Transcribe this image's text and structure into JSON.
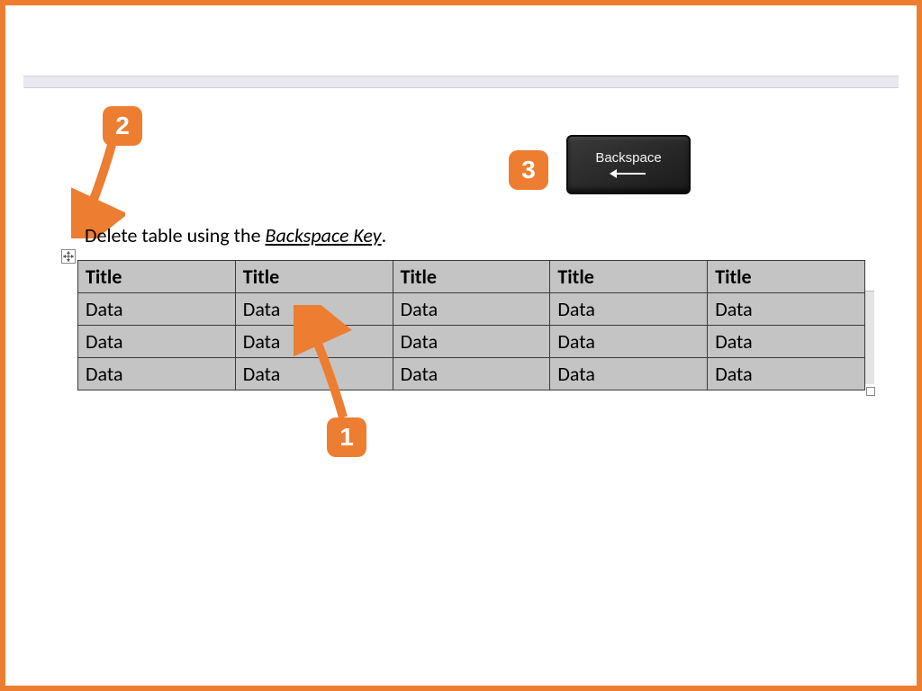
{
  "colors": {
    "accent": "#ed7d31",
    "cell_bg": "#c4c4c4"
  },
  "callouts": {
    "one": "1",
    "two": "2",
    "three": "3"
  },
  "key": {
    "label": "Backspace"
  },
  "instruction": {
    "prefix": "Delete table using the ",
    "emph": "Backspace Key",
    "suffix": "."
  },
  "table": {
    "headers": [
      "Title",
      "Title",
      "Title",
      "Title",
      "Title"
    ],
    "rows": [
      [
        "Data",
        "Data",
        "Data",
        "Data",
        "Data"
      ],
      [
        "Data",
        "Data",
        "Data",
        "Data",
        "Data"
      ],
      [
        "Data",
        "Data",
        "Data",
        "Data",
        "Data"
      ]
    ]
  }
}
